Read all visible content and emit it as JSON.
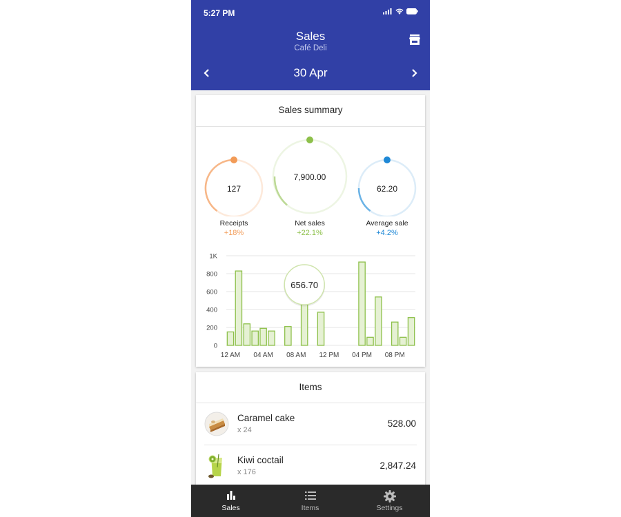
{
  "status_bar": {
    "time": "5:27 PM"
  },
  "header": {
    "title": "Sales",
    "subtitle": "Café Deli",
    "date": "30 Apr"
  },
  "summary": {
    "title": "Sales summary",
    "stats": [
      {
        "label": "Receipts",
        "value": "127",
        "change": "+18%",
        "color": "#f29b57"
      },
      {
        "label": "Net sales",
        "value": "7,900.00",
        "change": "+22.1%",
        "color": "#8dc04a"
      },
      {
        "label": "Average sale",
        "value": "62.20",
        "change": "+4.2%",
        "color": "#1e88d6"
      }
    ]
  },
  "chart_data": {
    "type": "bar",
    "x_tick_labels": [
      "12 AM",
      "04 AM",
      "08 AM",
      "12 PM",
      "04 PM",
      "08 PM"
    ],
    "y_tick_labels": [
      "0",
      "200",
      "400",
      "600",
      "800",
      "1K"
    ],
    "ylim": [
      0,
      1000
    ],
    "values": [
      150,
      830,
      240,
      160,
      190,
      160,
      0,
      210,
      0,
      650,
      0,
      370,
      0,
      0,
      0,
      0,
      930,
      90,
      540,
      0,
      260,
      90,
      310
    ],
    "tooltip_value": "656.70",
    "grid": true,
    "bar_color": "#8dc04a"
  },
  "items": {
    "title": "Items",
    "list": [
      {
        "name": "Caramel cake",
        "qty": "x 24",
        "amount": "528.00"
      },
      {
        "name": "Kiwi coctail",
        "qty": "x 176",
        "amount": "2,847.24"
      }
    ]
  },
  "nav": [
    {
      "label": "Sales",
      "active": true
    },
    {
      "label": "Items",
      "active": false
    },
    {
      "label": "Settings",
      "active": false
    }
  ]
}
